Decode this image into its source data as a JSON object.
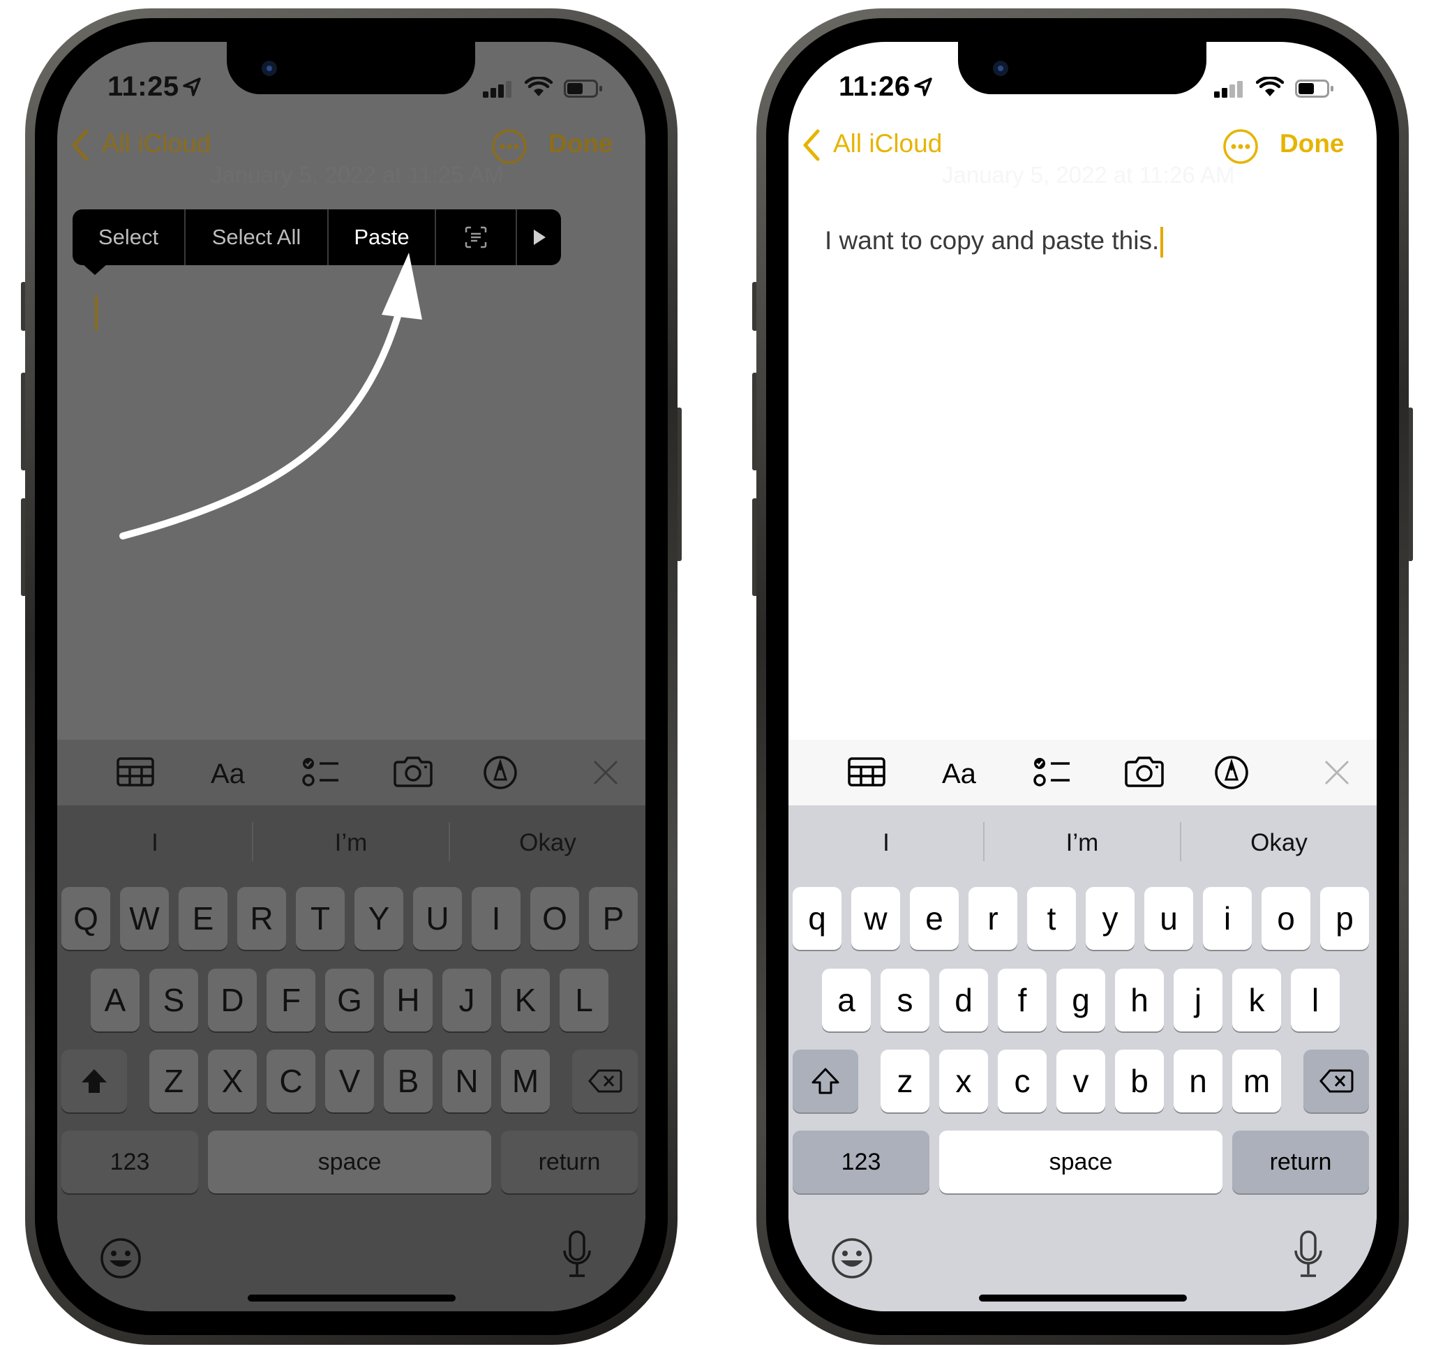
{
  "left_phone": {
    "status": {
      "time": "11:25"
    },
    "nav": {
      "back_label": "All iCloud",
      "done_label": "Done"
    },
    "note_date": "January 5, 2022 at 11:25 AM",
    "edit_menu": {
      "items": [
        "Select",
        "Select All",
        "Paste"
      ]
    },
    "predictions": [
      "I",
      "I’m",
      "Okay"
    ],
    "keyboard": {
      "row1": [
        "Q",
        "W",
        "E",
        "R",
        "T",
        "Y",
        "U",
        "I",
        "O",
        "P"
      ],
      "row2": [
        "A",
        "S",
        "D",
        "F",
        "G",
        "H",
        "J",
        "K",
        "L"
      ],
      "row3": [
        "Z",
        "X",
        "C",
        "V",
        "B",
        "N",
        "M"
      ],
      "numbers_label": "123",
      "space_label": "space",
      "return_label": "return"
    }
  },
  "right_phone": {
    "status": {
      "time": "11:26"
    },
    "nav": {
      "back_label": "All iCloud",
      "done_label": "Done"
    },
    "note_date": "January 5, 2022 at 11:26 AM",
    "note_text": "I want to copy and paste this.",
    "predictions": [
      "I",
      "I’m",
      "Okay"
    ],
    "keyboard": {
      "row1": [
        "q",
        "w",
        "e",
        "r",
        "t",
        "y",
        "u",
        "i",
        "o",
        "p"
      ],
      "row2": [
        "a",
        "s",
        "d",
        "f",
        "g",
        "h",
        "j",
        "k",
        "l"
      ],
      "row3": [
        "z",
        "x",
        "c",
        "v",
        "b",
        "n",
        "m"
      ],
      "numbers_label": "123",
      "space_label": "space",
      "return_label": "return"
    }
  },
  "colors": {
    "accent": "#E6B400",
    "accent_dimmed": "#8A6D1C",
    "overlay_gray": "#6A6A6A",
    "arrow": "#FFFFFF"
  },
  "icons": [
    "location-arrow-icon",
    "signal-icon",
    "wifi-icon",
    "battery-icon",
    "chevron-left-icon",
    "more-circle-icon",
    "table-icon",
    "text-format-icon",
    "checklist-icon",
    "camera-icon",
    "markup-pen-icon",
    "close-icon",
    "live-text-icon",
    "play-arrow-icon",
    "shift-icon",
    "delete-icon",
    "emoji-icon",
    "mic-icon",
    "curved-arrow-icon"
  ]
}
